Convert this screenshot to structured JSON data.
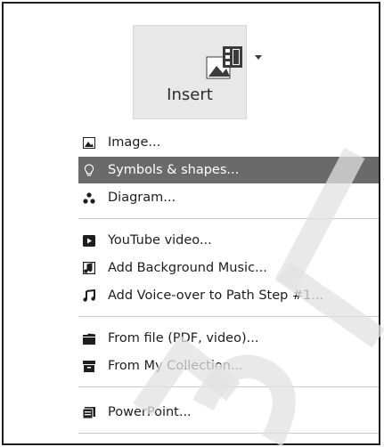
{
  "insert_button": {
    "label": "Insert"
  },
  "menu": {
    "items": [
      {
        "label": "Image...",
        "icon": "image-icon"
      },
      {
        "label": "Symbols & shapes...",
        "icon": "lightbulb-icon",
        "selected": true
      },
      {
        "label": "Diagram...",
        "icon": "diagram-icon"
      },
      {
        "label": "YouTube video...",
        "icon": "youtube-icon"
      },
      {
        "label": "Add Background Music...",
        "icon": "music-file-icon"
      },
      {
        "label": "Add Voice-over to Path Step #1...",
        "icon": "music-note-icon"
      },
      {
        "label": "From file (PDF, video)...",
        "icon": "folder-icon"
      },
      {
        "label": "From My Collection...",
        "icon": "collection-icon"
      },
      {
        "label": "PowerPoint...",
        "icon": "powerpoint-icon"
      }
    ]
  },
  "colors": {
    "selected_bg": "#6a6a6a",
    "button_bg": "#e8e8e8",
    "watermark": "#e2e2e2"
  }
}
